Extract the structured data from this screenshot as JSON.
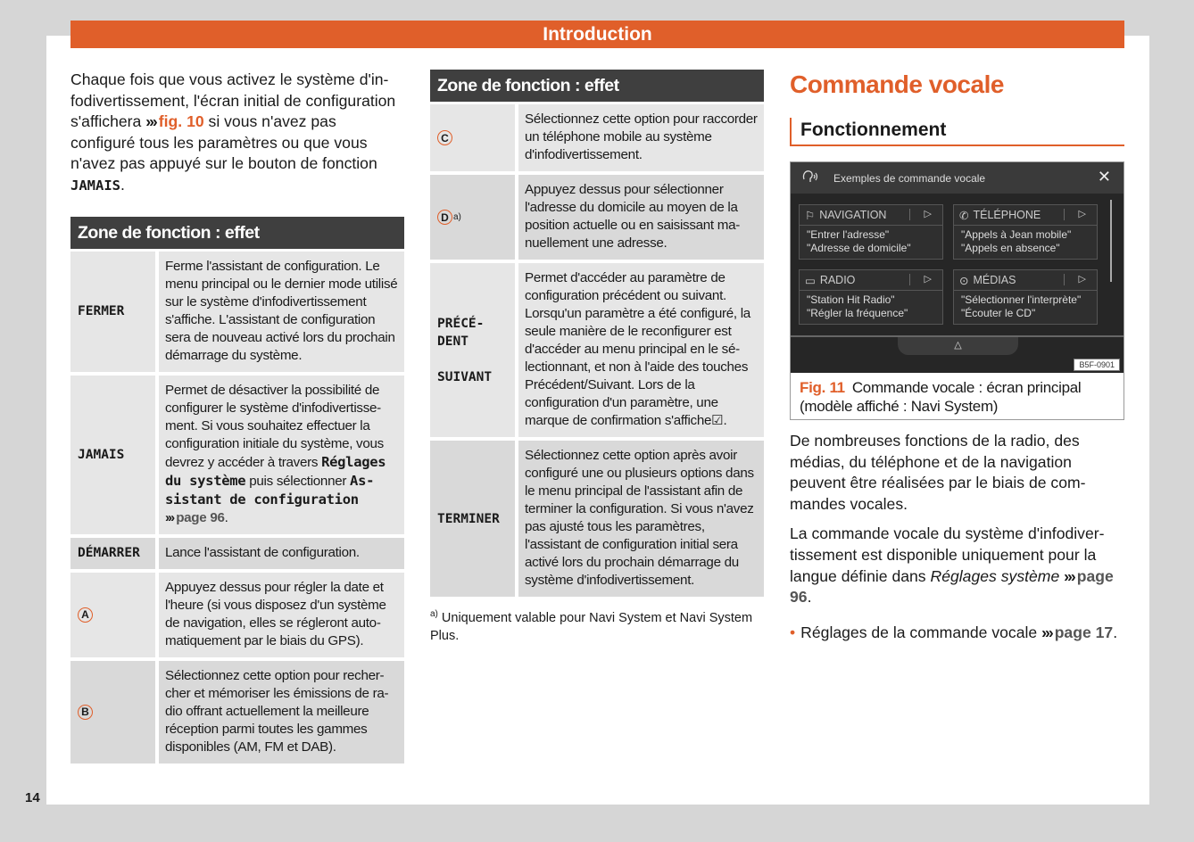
{
  "header": {
    "title": "Introduction"
  },
  "page_number": "14",
  "intro": {
    "text_before": "Chaque fois que vous activez le système d'in­fodivertissement, l'écran initial de configura­tion s'affichera ",
    "arrows": "›››",
    "fig_ref": "fig. 10",
    "text_after": " si vous n'avez pas configuré tous les paramètres ou que vous n'avez pas appuyé sur le bouton de fonction ",
    "button_name": "JAMAIS",
    "end": "."
  },
  "table_header": "Zone de fonction : effet",
  "table1": [
    {
      "key": "FERMER",
      "value": "Ferme l'assistant de configuration. Le menu principal ou le dernier mode uti­lisé sur le système d'infodivertissement s'affiche. L'assistant de configuration sera de nouveau activé lors du pro­chain démarrage du système."
    },
    {
      "key": "JAMAIS",
      "value_start": "Permet de désactiver la possibilité de configurer le système d'infodivertisse­ment. Si vous souhaitez effectuer la configuration initiale du système, vous devrez y accéder à travers ",
      "bold1": "Réglages du système",
      "mid": " puis sélectionner ",
      "bold2": "As­sistant de configuration",
      "arrows": "›››",
      "ref": "page 96",
      "end": "."
    },
    {
      "key": "DÉMARRER",
      "value": "Lance l'assistant de configuration."
    },
    {
      "key": "A",
      "value": "Appuyez dessus pour régler la date et l'heure (si vous disposez d'un système de navigation, elles se régleront auto­matiquement par le biais du GPS)."
    },
    {
      "key": "B",
      "value": "Sélectionnez cette option pour recher­cher et mémoriser les émissions de ra­dio offrant actuellement la meilleure réception parmi toutes les gammes disponibles (AM, FM et DAB)."
    }
  ],
  "table2": [
    {
      "key": "C",
      "value": "Sélectionnez cette option pour raccor­der un téléphone mobile au système d'infodivertissement."
    },
    {
      "key": "D",
      "key_sup": "a)",
      "value": "Appuyez dessus pour sélectionner l'adresse du domicile au moyen de la position actuelle ou en saisissant ma­nuellement une adresse."
    },
    {
      "key1": "PRÉCÉ-",
      "key2": "DENT",
      "key3": "SUIVANT",
      "value": "Permet d'accéder au paramètre de configuration précédent ou suivant. Lorsqu'un paramètre a été configuré, la seule manière de le reconfigurer est d'accéder au menu principal en le sé­lectionnant, et non à l'aide des tou­ches Précédent/Suivant. Lors de la configuration d'un paramè­tre, une marque de confirmation s'affi­che",
      "check": "☑",
      "end": "."
    },
    {
      "key": "TERMINER",
      "value": "Sélectionnez cette option après avoir configuré une ou plusieurs options dans le menu principal de l'assistant afin de terminer la configuration. Si vous n'avez pas ajusté tous les para­mètres, l'assistant de configuration ini­tial sera activé lors du prochain dé­marrage du système d'infodivertisse­ment."
    }
  ],
  "footnote": {
    "mark": "a)",
    "text": "Uniquement valable pour Navi System et Navi Sys­tem Plus."
  },
  "section": {
    "title": "Commande vocale",
    "subtitle": "Fonctionnement"
  },
  "screen": {
    "title": "Exemples de commande vocale",
    "close_icon": "✕",
    "tiles": [
      {
        "icon": "flag-icon",
        "glyph": "⚐",
        "label": "NAVIGATION",
        "lines": [
          "\"Entrer l'adresse\"",
          "\"Adresse de domicile\""
        ]
      },
      {
        "icon": "phone-icon",
        "glyph": "✆",
        "label": "TÉLÉPHONE",
        "lines": [
          "\"Appels à Jean mobile\"",
          "\"Appels en absence\""
        ]
      },
      {
        "icon": "radio-icon",
        "glyph": "▭",
        "label": "RADIO",
        "lines": [
          "\"Station Hit Radio\"",
          "\"Régler la fréquence\""
        ]
      },
      {
        "icon": "media-play-icon",
        "glyph": "⊙",
        "label": "MÉDIAS",
        "lines": [
          "\"Sélectionner l'interprète\"",
          "\"Écouter le CD\""
        ]
      }
    ],
    "play_glyph": "▷",
    "up_glyph": "△",
    "image_code": "B5F-0901"
  },
  "figure_caption": {
    "label": "Fig. 11",
    "text": "Commande vocale : écran principal (modèle affiché : Navi System)"
  },
  "paragraphs": {
    "p1": "De nombreuses fonctions de la radio, des médias, du téléphone et de la navigation peuvent être réalisées par le biais de com­mandes vocales.",
    "p2_start": "La commande vocale du système d'infodiver­tissement est disponible uniquement pour la langue définie dans ",
    "p2_italic": "Réglages système",
    "p2_arrows": "›››",
    "p2_ref": "pa­ge 96",
    "p2_end": ".",
    "bullet": "•",
    "b1_text": "Réglages de la commande vocale ",
    "b1_arrows": "›››",
    "b1_ref": "pa­ge 17",
    "b1_end": "."
  },
  "colors": {
    "accent": "#e05f2a",
    "table_header": "#3f3f3f",
    "cell_light": "#e6e6e6",
    "cell_dark": "#d9d9d9",
    "background": "#d6d6d6"
  }
}
